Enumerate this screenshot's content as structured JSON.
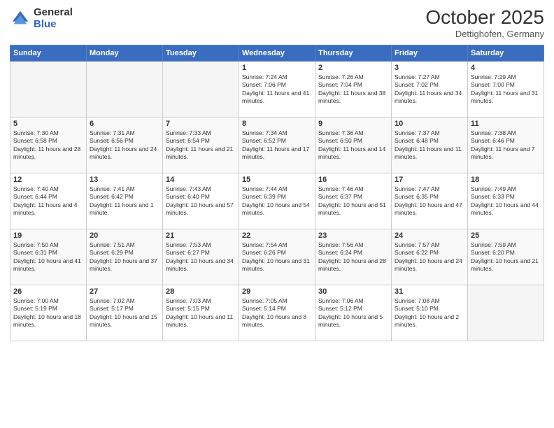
{
  "logo": {
    "general": "General",
    "blue": "Blue"
  },
  "header": {
    "month": "October 2025",
    "location": "Dettighofen, Germany"
  },
  "days_of_week": [
    "Sunday",
    "Monday",
    "Tuesday",
    "Wednesday",
    "Thursday",
    "Friday",
    "Saturday"
  ],
  "weeks": [
    [
      {
        "day": "",
        "sunrise": "",
        "sunset": "",
        "daylight": ""
      },
      {
        "day": "",
        "sunrise": "",
        "sunset": "",
        "daylight": ""
      },
      {
        "day": "",
        "sunrise": "",
        "sunset": "",
        "daylight": ""
      },
      {
        "day": "1",
        "sunrise": "Sunrise: 7:24 AM",
        "sunset": "Sunset: 7:06 PM",
        "daylight": "Daylight: 11 hours and 41 minutes."
      },
      {
        "day": "2",
        "sunrise": "Sunrise: 7:26 AM",
        "sunset": "Sunset: 7:04 PM",
        "daylight": "Daylight: 11 hours and 38 minutes."
      },
      {
        "day": "3",
        "sunrise": "Sunrise: 7:27 AM",
        "sunset": "Sunset: 7:02 PM",
        "daylight": "Daylight: 11 hours and 34 minutes."
      },
      {
        "day": "4",
        "sunrise": "Sunrise: 7:29 AM",
        "sunset": "Sunset: 7:00 PM",
        "daylight": "Daylight: 11 hours and 31 minutes."
      }
    ],
    [
      {
        "day": "5",
        "sunrise": "Sunrise: 7:30 AM",
        "sunset": "Sunset: 6:58 PM",
        "daylight": "Daylight: 11 hours and 28 minutes."
      },
      {
        "day": "6",
        "sunrise": "Sunrise: 7:31 AM",
        "sunset": "Sunset: 6:56 PM",
        "daylight": "Daylight: 11 hours and 24 minutes."
      },
      {
        "day": "7",
        "sunrise": "Sunrise: 7:33 AM",
        "sunset": "Sunset: 6:54 PM",
        "daylight": "Daylight: 11 hours and 21 minutes."
      },
      {
        "day": "8",
        "sunrise": "Sunrise: 7:34 AM",
        "sunset": "Sunset: 6:52 PM",
        "daylight": "Daylight: 11 hours and 17 minutes."
      },
      {
        "day": "9",
        "sunrise": "Sunrise: 7:36 AM",
        "sunset": "Sunset: 6:50 PM",
        "daylight": "Daylight: 11 hours and 14 minutes."
      },
      {
        "day": "10",
        "sunrise": "Sunrise: 7:37 AM",
        "sunset": "Sunset: 6:48 PM",
        "daylight": "Daylight: 11 hours and 11 minutes."
      },
      {
        "day": "11",
        "sunrise": "Sunrise: 7:38 AM",
        "sunset": "Sunset: 6:46 PM",
        "daylight": "Daylight: 11 hours and 7 minutes."
      }
    ],
    [
      {
        "day": "12",
        "sunrise": "Sunrise: 7:40 AM",
        "sunset": "Sunset: 6:44 PM",
        "daylight": "Daylight: 11 hours and 4 minutes."
      },
      {
        "day": "13",
        "sunrise": "Sunrise: 7:41 AM",
        "sunset": "Sunset: 6:42 PM",
        "daylight": "Daylight: 11 hours and 1 minute."
      },
      {
        "day": "14",
        "sunrise": "Sunrise: 7:43 AM",
        "sunset": "Sunset: 6:40 PM",
        "daylight": "Daylight: 10 hours and 57 minutes."
      },
      {
        "day": "15",
        "sunrise": "Sunrise: 7:44 AM",
        "sunset": "Sunset: 6:39 PM",
        "daylight": "Daylight: 10 hours and 54 minutes."
      },
      {
        "day": "16",
        "sunrise": "Sunrise: 7:46 AM",
        "sunset": "Sunset: 6:37 PM",
        "daylight": "Daylight: 10 hours and 51 minutes."
      },
      {
        "day": "17",
        "sunrise": "Sunrise: 7:47 AM",
        "sunset": "Sunset: 6:35 PM",
        "daylight": "Daylight: 10 hours and 47 minutes."
      },
      {
        "day": "18",
        "sunrise": "Sunrise: 7:49 AM",
        "sunset": "Sunset: 6:33 PM",
        "daylight": "Daylight: 10 hours and 44 minutes."
      }
    ],
    [
      {
        "day": "19",
        "sunrise": "Sunrise: 7:50 AM",
        "sunset": "Sunset: 6:31 PM",
        "daylight": "Daylight: 10 hours and 41 minutes."
      },
      {
        "day": "20",
        "sunrise": "Sunrise: 7:51 AM",
        "sunset": "Sunset: 6:29 PM",
        "daylight": "Daylight: 10 hours and 37 minutes."
      },
      {
        "day": "21",
        "sunrise": "Sunrise: 7:53 AM",
        "sunset": "Sunset: 6:27 PM",
        "daylight": "Daylight: 10 hours and 34 minutes."
      },
      {
        "day": "22",
        "sunrise": "Sunrise: 7:54 AM",
        "sunset": "Sunset: 6:26 PM",
        "daylight": "Daylight: 10 hours and 31 minutes."
      },
      {
        "day": "23",
        "sunrise": "Sunrise: 7:56 AM",
        "sunset": "Sunset: 6:24 PM",
        "daylight": "Daylight: 10 hours and 28 minutes."
      },
      {
        "day": "24",
        "sunrise": "Sunrise: 7:57 AM",
        "sunset": "Sunset: 6:22 PM",
        "daylight": "Daylight: 10 hours and 24 minutes."
      },
      {
        "day": "25",
        "sunrise": "Sunrise: 7:59 AM",
        "sunset": "Sunset: 6:20 PM",
        "daylight": "Daylight: 10 hours and 21 minutes."
      }
    ],
    [
      {
        "day": "26",
        "sunrise": "Sunrise: 7:00 AM",
        "sunset": "Sunset: 5:19 PM",
        "daylight": "Daylight: 10 hours and 18 minutes."
      },
      {
        "day": "27",
        "sunrise": "Sunrise: 7:02 AM",
        "sunset": "Sunset: 5:17 PM",
        "daylight": "Daylight: 10 hours and 15 minutes."
      },
      {
        "day": "28",
        "sunrise": "Sunrise: 7:03 AM",
        "sunset": "Sunset: 5:15 PM",
        "daylight": "Daylight: 10 hours and 11 minutes."
      },
      {
        "day": "29",
        "sunrise": "Sunrise: 7:05 AM",
        "sunset": "Sunset: 5:14 PM",
        "daylight": "Daylight: 10 hours and 8 minutes."
      },
      {
        "day": "30",
        "sunrise": "Sunrise: 7:06 AM",
        "sunset": "Sunset: 5:12 PM",
        "daylight": "Daylight: 10 hours and 5 minutes."
      },
      {
        "day": "31",
        "sunrise": "Sunrise: 7:08 AM",
        "sunset": "Sunset: 5:10 PM",
        "daylight": "Daylight: 10 hours and 2 minutes."
      },
      {
        "day": "",
        "sunrise": "",
        "sunset": "",
        "daylight": ""
      }
    ]
  ]
}
